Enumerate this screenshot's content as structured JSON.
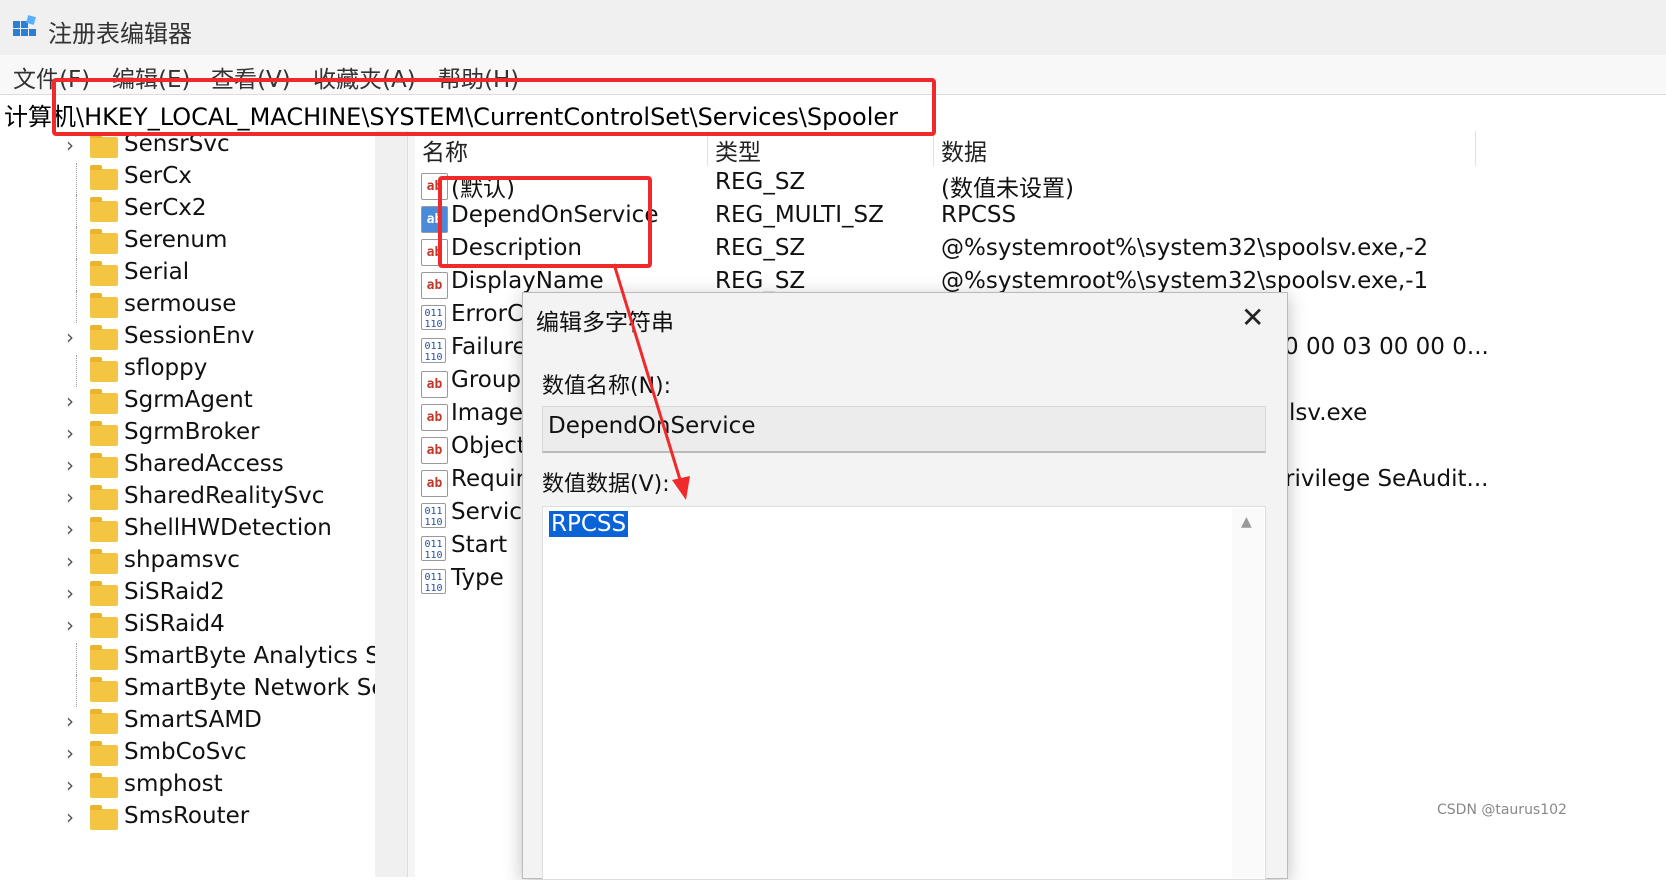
{
  "window": {
    "title": "注册表编辑器",
    "icon": "registry-icon"
  },
  "menu": [
    "文件(F)",
    "编辑(E)",
    "查看(V)",
    "收藏夹(A)",
    "帮助(H)"
  ],
  "address": "计算机\\HKEY_LOCAL_MACHINE\\SYSTEM\\CurrentControlSet\\Services\\Spooler",
  "tree": {
    "items": [
      {
        "label": "SensrSvc",
        "expandable": true
      },
      {
        "label": "SerCx",
        "expandable": false
      },
      {
        "label": "SerCx2",
        "expandable": false
      },
      {
        "label": "Serenum",
        "expandable": false
      },
      {
        "label": "Serial",
        "expandable": false
      },
      {
        "label": "sermouse",
        "expandable": false
      },
      {
        "label": "SessionEnv",
        "expandable": true
      },
      {
        "label": "sfloppy",
        "expandable": false
      },
      {
        "label": "SgrmAgent",
        "expandable": true
      },
      {
        "label": "SgrmBroker",
        "expandable": true
      },
      {
        "label": "SharedAccess",
        "expandable": true
      },
      {
        "label": "SharedRealitySvc",
        "expandable": true
      },
      {
        "label": "ShellHWDetection",
        "expandable": true
      },
      {
        "label": "shpamsvc",
        "expandable": true
      },
      {
        "label": "SiSRaid2",
        "expandable": true
      },
      {
        "label": "SiSRaid4",
        "expandable": true
      },
      {
        "label": "SmartByte Analytics Se",
        "expandable": false
      },
      {
        "label": "SmartByte Network Ser",
        "expandable": false
      },
      {
        "label": "SmartSAMD",
        "expandable": true
      },
      {
        "label": "SmbCoSvc",
        "expandable": true
      },
      {
        "label": "smphost",
        "expandable": true
      },
      {
        "label": "SmsRouter",
        "expandable": true
      }
    ]
  },
  "values": {
    "columns": [
      "名称",
      "类型",
      "数据"
    ],
    "rows": [
      {
        "name": "(默认)",
        "type": "REG_SZ",
        "data": "(数值未设置)",
        "icon": "ab"
      },
      {
        "name": "DependOnService",
        "type": "REG_MULTI_SZ",
        "data": "RPCSS",
        "icon": "ab"
      },
      {
        "name": "Description",
        "type": "REG_SZ",
        "data": "@%systemroot%\\system32\\spoolsv.exe,-2",
        "icon": "ab"
      },
      {
        "name": "DisplayName",
        "type": "REG_SZ",
        "data": "@%systemroot%\\system32\\spoolsv.exe,-1",
        "icon": "ab"
      },
      {
        "name": "ErrorC",
        "type": "",
        "data": "",
        "icon": "bin"
      },
      {
        "name": "Failure",
        "type": "",
        "data": "0 00 03 00 00 0...",
        "icon": "bin"
      },
      {
        "name": "Group",
        "type": "",
        "data": "",
        "icon": "ab"
      },
      {
        "name": "ImageI",
        "type": "",
        "data": "lsv.exe",
        "icon": "ab"
      },
      {
        "name": "Object",
        "type": "",
        "data": "",
        "icon": "ab"
      },
      {
        "name": "Requir",
        "type": "",
        "data": "rivilege SeAudit...",
        "icon": "ab"
      },
      {
        "name": "Service",
        "type": "",
        "data": "",
        "icon": "bin"
      },
      {
        "name": "Start",
        "type": "",
        "data": "",
        "icon": "bin"
      },
      {
        "name": "Type",
        "type": "",
        "data": "",
        "icon": "bin"
      }
    ]
  },
  "dialog": {
    "title": "编辑多字符串",
    "name_label": "数值名称(N):",
    "name_value": "DependOnService",
    "data_label": "数值数据(V):",
    "data_value": "RPCSS"
  },
  "watermark": "CSDN @taurus102",
  "colors": {
    "highlight": "#f02a2a",
    "selection": "#0a64d8",
    "folder": "#f4c542"
  }
}
